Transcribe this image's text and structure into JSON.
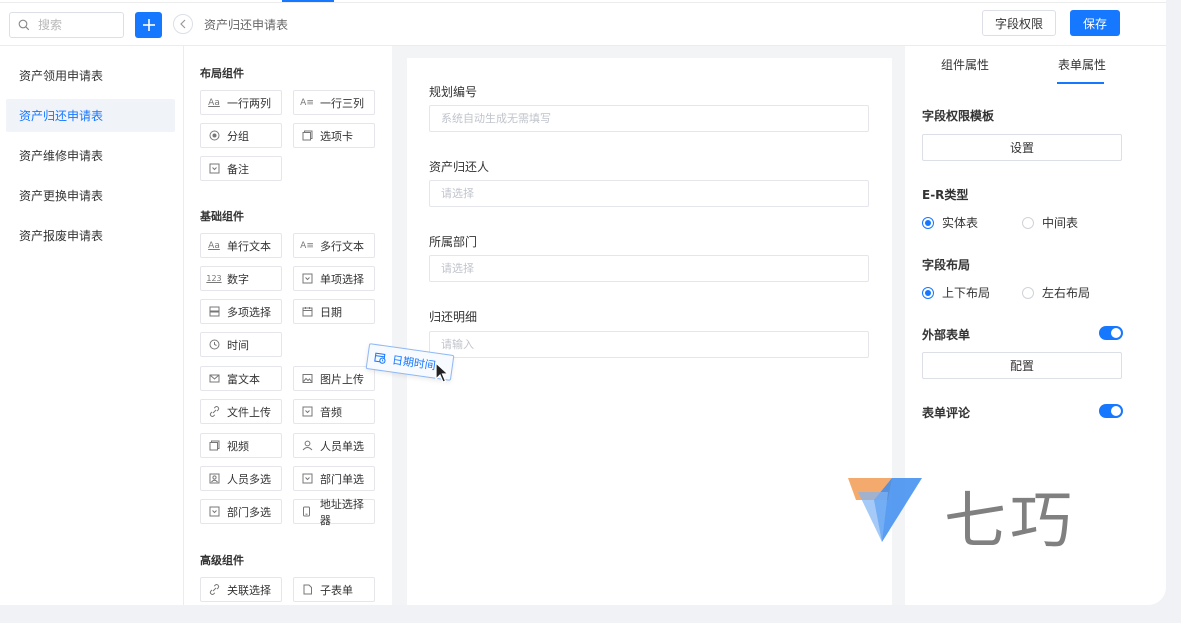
{
  "header": {
    "search_placeholder": "搜索",
    "page_title": "资产归还申请表",
    "perm_button": "字段权限",
    "save_button": "保存"
  },
  "sidebar": {
    "items": [
      {
        "label": "资产领用申请表",
        "active": false
      },
      {
        "label": "资产归还申请表",
        "active": true
      },
      {
        "label": "资产维修申请表",
        "active": false
      },
      {
        "label": "资产更换申请表",
        "active": false
      },
      {
        "label": "资产报废申请表",
        "active": false
      }
    ]
  },
  "palette": {
    "layout_title": "布局组件",
    "layout_items": [
      {
        "label": "一行两列",
        "icon": "aa-icon"
      },
      {
        "label": "一行三列",
        "icon": "aa-lines-icon"
      },
      {
        "label": "分组",
        "icon": "radio-icon"
      },
      {
        "label": "选项卡",
        "icon": "tabs-icon"
      },
      {
        "label": "备注",
        "icon": "dropdown-box-icon"
      }
    ],
    "basic_title": "基础组件",
    "basic_items": [
      {
        "label": "单行文本",
        "icon": "aa-icon"
      },
      {
        "label": "多行文本",
        "icon": "aa-lines-icon"
      },
      {
        "label": "数字",
        "icon": "number-icon"
      },
      {
        "label": "单项选择",
        "icon": "dropdown-box-icon"
      },
      {
        "label": "多项选择",
        "icon": "list-icon"
      },
      {
        "label": "日期",
        "icon": "calendar-icon"
      },
      {
        "label": "时间",
        "icon": "clock-icon"
      },
      {
        "label": "富文本",
        "icon": "mail-icon"
      },
      {
        "label": "图片上传",
        "icon": "image-icon"
      },
      {
        "label": "文件上传",
        "icon": "link-icon"
      },
      {
        "label": "音频",
        "icon": "dropdown-box-icon"
      },
      {
        "label": "视频",
        "icon": "tabs-icon"
      },
      {
        "label": "人员单选",
        "icon": "user-icon"
      },
      {
        "label": "人员多选",
        "icon": "users-icon"
      },
      {
        "label": "部门单选",
        "icon": "dropdown-box-icon"
      },
      {
        "label": "部门多选",
        "icon": "dropdown-box-icon"
      },
      {
        "label": "地址选择器",
        "icon": "phone-icon"
      }
    ],
    "advanced_title": "高级组件",
    "advanced_items": [
      {
        "label": "关联选择",
        "icon": "link-icon"
      },
      {
        "label": "子表单",
        "icon": "file-icon"
      }
    ]
  },
  "form": {
    "fields": [
      {
        "label": "规划编号",
        "placeholder": "系统自动生成无需填写"
      },
      {
        "label": "资产归还人",
        "placeholder": "请选择"
      },
      {
        "label": "所属部门",
        "placeholder": "请选择"
      },
      {
        "label": "归还明细",
        "placeholder": "请输入"
      }
    ]
  },
  "drag": {
    "label": "日期时间",
    "icon": "calendar-clock-icon"
  },
  "properties": {
    "tabs": [
      "组件属性",
      "表单属性"
    ],
    "active_tab": "表单属性",
    "perm_template_title": "字段权限模板",
    "perm_template_button": "设置",
    "er_type_title": "E-R类型",
    "er_options": [
      {
        "label": "实体表",
        "selected": true
      },
      {
        "label": "中间表",
        "selected": false
      }
    ],
    "layout_title": "字段布局",
    "layout_options": [
      {
        "label": "上下布局",
        "selected": true
      },
      {
        "label": "左右布局",
        "selected": false
      }
    ],
    "external_form_title": "外部表单",
    "external_form_enabled": true,
    "external_form_button": "配置",
    "comment_title": "表单评论",
    "comment_enabled": true
  },
  "watermark": {
    "text": "七巧"
  },
  "colors": {
    "accent": "#1677ff",
    "watermark_orange": "#f4a15d",
    "watermark_blue": "#3b8cf0"
  }
}
